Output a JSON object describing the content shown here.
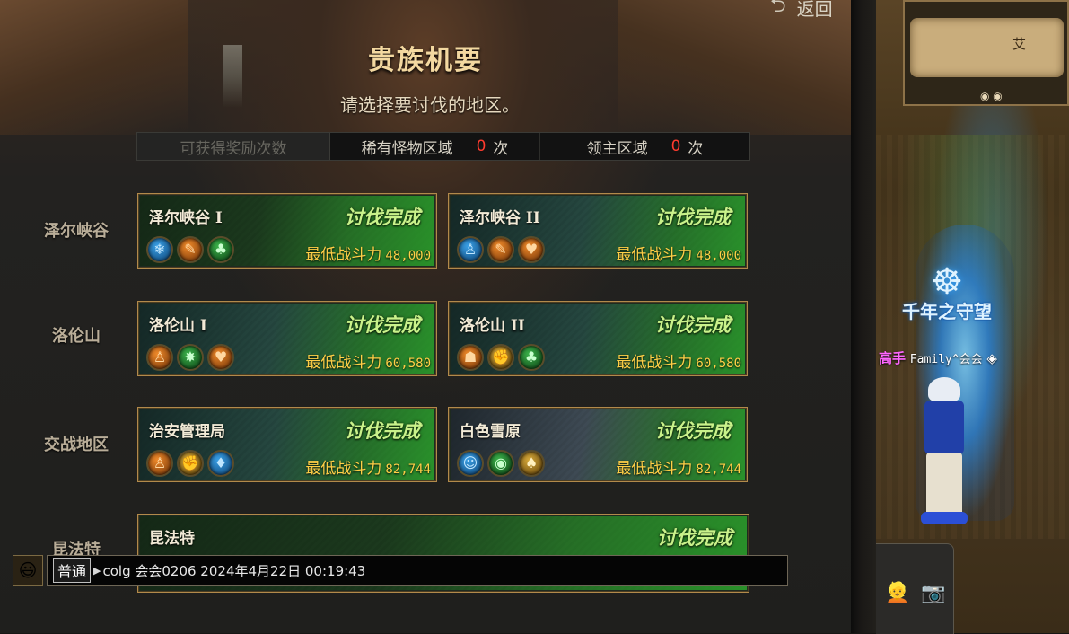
{
  "header": {
    "title": "贵族机要",
    "subtitle": "请选择要讨伐的地区。",
    "return_label": "返回",
    "return_icon": "return-arrow-icon"
  },
  "reward_bar": {
    "label": "可获得奖励次数",
    "rare_area": {
      "label": "稀有怪物区域",
      "count": "0",
      "unit": "次"
    },
    "boss_area": {
      "label": "领主区域",
      "count": "0",
      "unit": "次"
    }
  },
  "regions": [
    {
      "name": "泽尔峡谷"
    },
    {
      "name": "洛伦山"
    },
    {
      "name": "交战地区"
    },
    {
      "name": "昆法特"
    }
  ],
  "dungeons": [
    {
      "name": "泽尔峡谷 I",
      "status": "讨伐完成",
      "power_label": "最低战斗力",
      "power_value": "48,000",
      "icons": [
        "snowflake-icon",
        "feather-icon",
        "club-icon"
      ]
    },
    {
      "name": "泽尔峡谷 II",
      "status": "讨伐完成",
      "power_label": "最低战斗力",
      "power_value": "48,000",
      "icons": [
        "figure-icon",
        "feather-icon",
        "heart-icon"
      ]
    },
    {
      "name": "洛伦山 I",
      "status": "讨伐完成",
      "power_label": "最低战斗力",
      "power_value": "60,580",
      "icons": [
        "figure-icon",
        "star-icon",
        "heart-icon"
      ]
    },
    {
      "name": "洛伦山 II",
      "status": "讨伐完成",
      "power_label": "最低战斗力",
      "power_value": "60,580",
      "icons": [
        "mushroom-icon",
        "fist-icon",
        "club-icon"
      ]
    },
    {
      "name": "治安管理局",
      "status": "讨伐完成",
      "power_label": "最低战斗力",
      "power_value": "82,744",
      "icons": [
        "figure-icon",
        "fist-icon",
        "diamond-icon"
      ]
    },
    {
      "name": "白色雪原",
      "status": "讨伐完成",
      "power_label": "最低战斗力",
      "power_value": "82,744",
      "icons": [
        "face-icon",
        "eye-icon",
        "spade-icon"
      ]
    },
    {
      "name": "昆法特",
      "status": "讨伐完成"
    }
  ],
  "chat": {
    "channel": "普通",
    "message": "colg 会会0206 2024年4月22日 00:19:43"
  },
  "scene": {
    "guild_name": "千年之守望",
    "player_title": "高手",
    "player_tag": "Family^会会",
    "minimap_label": "艾"
  },
  "colors": {
    "status_text": "#c9f28a",
    "power_text": "#ffcf47",
    "count_text": "#ff3b2e",
    "card_border": "#b28a4b"
  }
}
